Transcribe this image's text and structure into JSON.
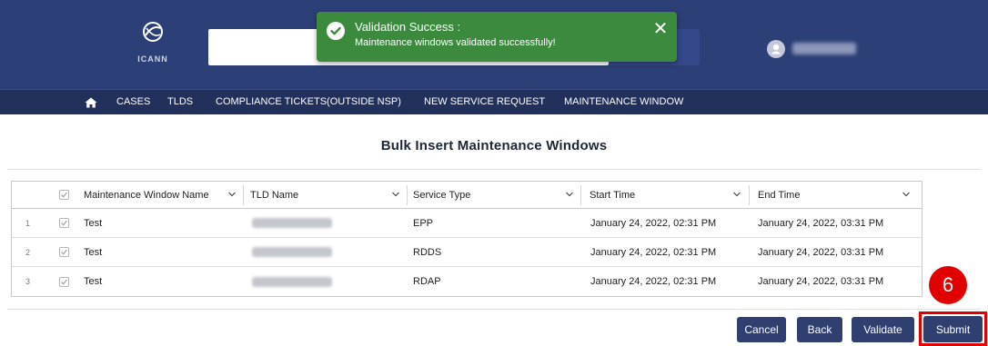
{
  "header": {
    "logo_text": "ICANN"
  },
  "toast": {
    "title": "Validation Success :",
    "message": "Maintenance windows validated successfully!",
    "close_glyph": "✕",
    "icon": "check-circle-icon",
    "color": "#3b8a3e"
  },
  "nav": {
    "items": [
      "CASES",
      "TLDS",
      "COMPLIANCE TICKETS(OUTSIDE NSP)",
      "NEW SERVICE REQUEST",
      "MAINTENANCE WINDOW"
    ]
  },
  "page": {
    "title": "Bulk Insert Maintenance Windows"
  },
  "table": {
    "columns": [
      "Maintenance Window Name",
      "TLD Name",
      "Service Type",
      "Start Time",
      "End Time"
    ],
    "rows": [
      {
        "num": "1",
        "name": "Test",
        "service": "EPP",
        "start": "January 24, 2022, 02:31 PM",
        "end": "January 24, 2022, 03:31 PM"
      },
      {
        "num": "2",
        "name": "Test",
        "service": "RDDS",
        "start": "January 24, 2022, 02:31 PM",
        "end": "January 24, 2022, 03:31 PM"
      },
      {
        "num": "3",
        "name": "Test",
        "service": "RDAP",
        "start": "January 24, 2022, 02:31 PM",
        "end": "January 24, 2022, 03:31 PM"
      }
    ]
  },
  "buttons": {
    "cancel": "Cancel",
    "back": "Back",
    "validate": "Validate",
    "submit": "Submit"
  },
  "annotation": {
    "step": "6",
    "color": "#e00000"
  }
}
